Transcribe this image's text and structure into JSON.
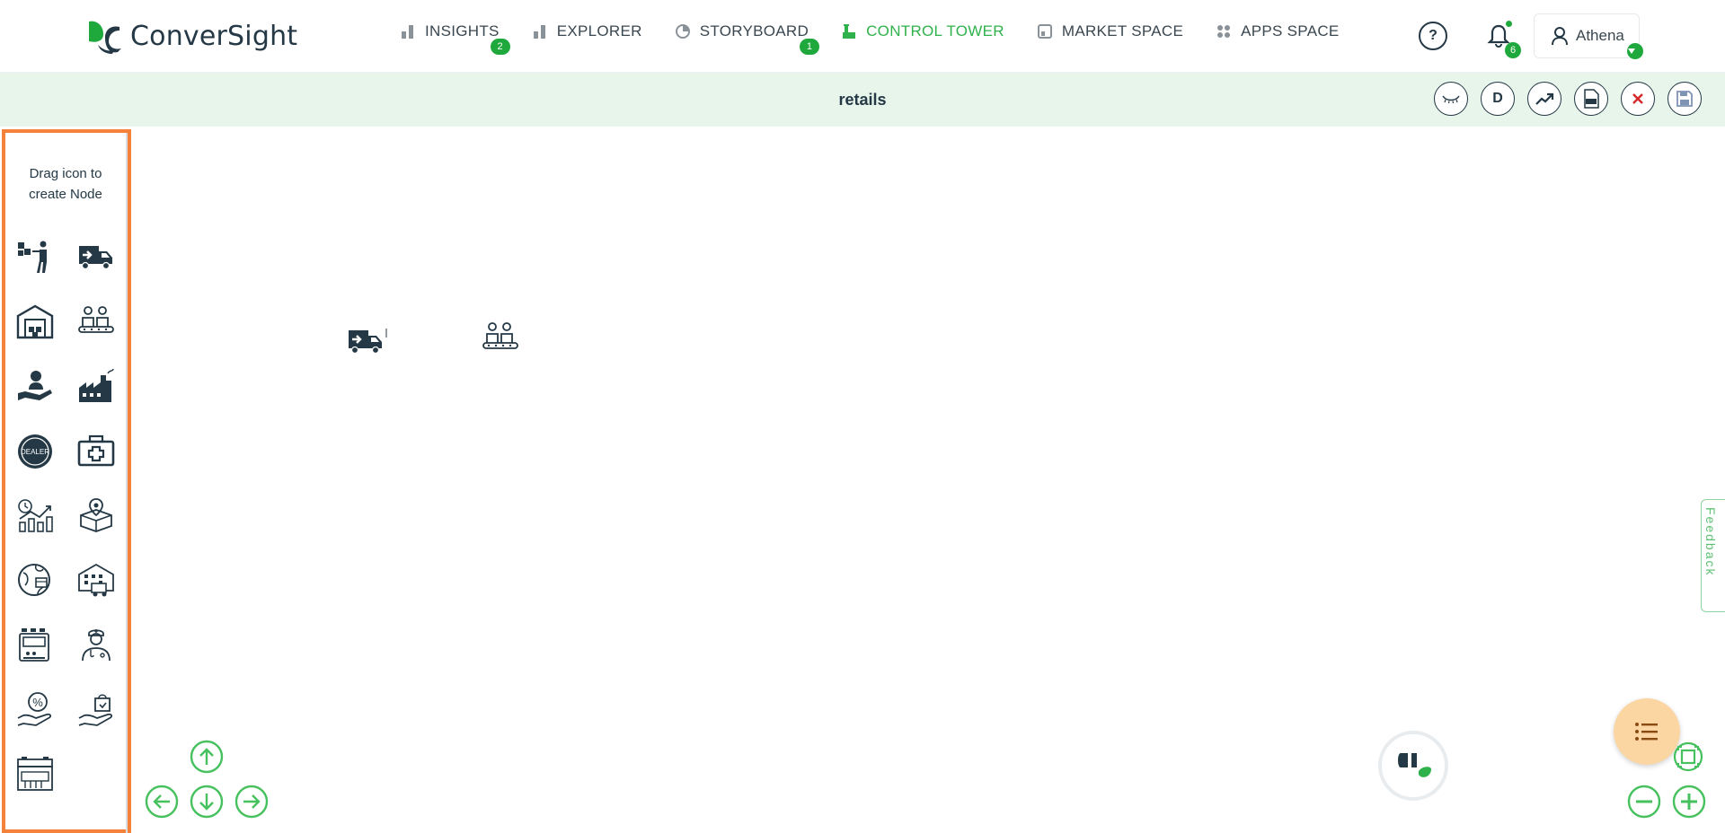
{
  "app": {
    "brand": "ConverSight"
  },
  "nav": {
    "items": [
      {
        "label": "INSIGHTS",
        "badge": "2",
        "icon": "bar-chart-icon",
        "active": false
      },
      {
        "label": "EXPLORER",
        "badge": "",
        "icon": "bar-chart-icon",
        "active": false
      },
      {
        "label": "STORYBOARD",
        "badge": "1",
        "icon": "pie-icon",
        "active": false
      },
      {
        "label": "CONTROL TOWER",
        "badge": "",
        "icon": "control-tower-icon",
        "active": true
      },
      {
        "label": "MARKET SPACE",
        "badge": "",
        "icon": "market-icon",
        "active": false
      },
      {
        "label": "APPS SPACE",
        "badge": "",
        "icon": "apps-grid-icon",
        "active": false
      }
    ]
  },
  "header": {
    "help_label": "?",
    "notifications_count": "6",
    "user_name": "Athena"
  },
  "titlebar": {
    "title": "retails",
    "tools": [
      {
        "icon": "eye-closed-icon",
        "label": ""
      },
      {
        "icon": "d-letter-icon",
        "label": "D"
      },
      {
        "icon": "trend-icon",
        "label": ""
      },
      {
        "icon": "pdf-icon",
        "label": ""
      },
      {
        "icon": "close-icon",
        "label": ""
      },
      {
        "icon": "save-icon",
        "label": ""
      }
    ]
  },
  "palette": {
    "title_line1": "Drag icon to",
    "title_line2": "create Node",
    "icons": [
      "supplier-icon",
      "delivery-truck-icon",
      "warehouse-icon",
      "factory-workers-icon",
      "customer-care-icon",
      "factory-icon",
      "dealer-icon",
      "first-aid-kit-icon",
      "growth-chart-icon",
      "package-location-icon",
      "global-delivery-icon",
      "distribution-center-icon",
      "machine-icon",
      "doctor-icon",
      "discount-hand-icon",
      "shopping-hand-icon",
      "store-icon"
    ]
  },
  "canvas": {
    "nodes": [
      "delivery-truck-icon",
      "factory-workers-icon"
    ]
  },
  "feedback": {
    "label": "Feedback"
  },
  "colors": {
    "accent_green": "#2fb24c",
    "badge_green": "#1fa83c",
    "titlebar_bg": "#e8f5eb",
    "palette_border": "#f5823a",
    "fab_bg": "#fbd6a3",
    "dark_text": "#243845",
    "close_red": "#d62828"
  }
}
